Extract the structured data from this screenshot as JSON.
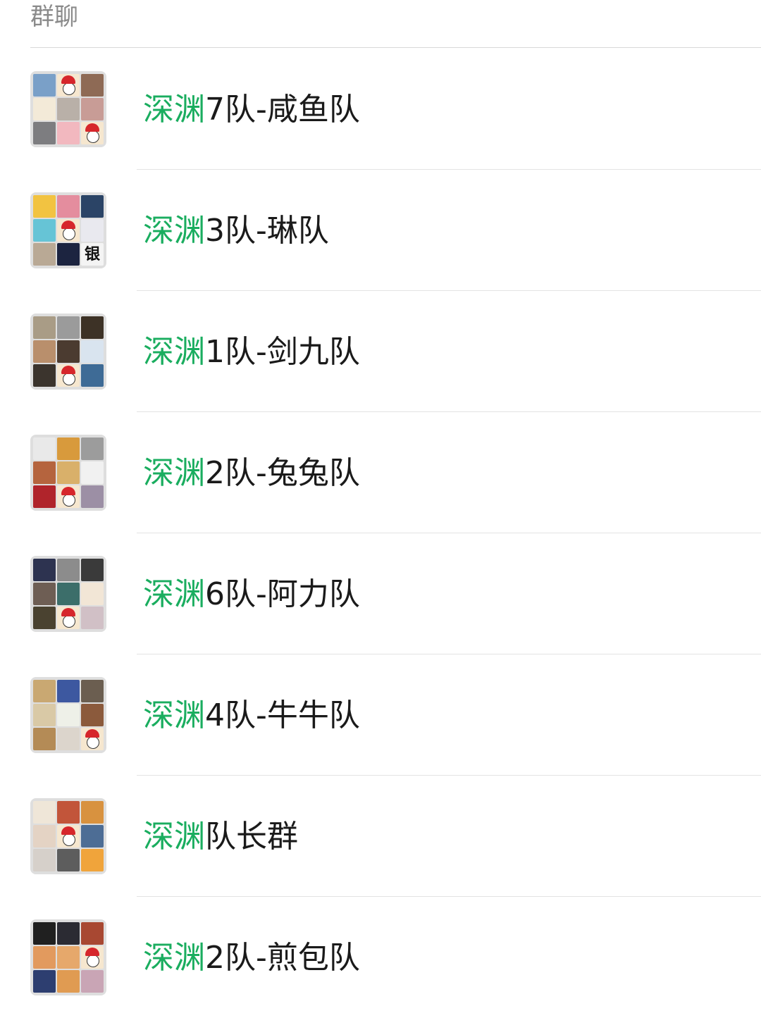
{
  "section": {
    "title": "群聊"
  },
  "colors": {
    "highlight": "#1aad5f",
    "text": "#1a1a1a",
    "header": "#8a8a8a"
  },
  "groups": [
    {
      "match": "深渊",
      "rest": "7队-咸鱼队",
      "avatar_tiles": [
        "#7aa0c8",
        "santa",
        "#8e6a55",
        "#f3ead8",
        "#b9b0a8",
        "#c89c96",
        "#7d7d80",
        "#f2b8bf",
        "santa"
      ]
    },
    {
      "match": "深渊",
      "rest": "3队-琳队",
      "avatar_tiles": [
        "#f2c341",
        "#e48d9e",
        "#2b4466",
        "#66c4d6",
        "santa",
        "#e9e9ef",
        "#b9a995",
        "#1c2440",
        "glyph:银"
      ]
    },
    {
      "match": "深渊",
      "rest": "1队-剑九队",
      "avatar_tiles": [
        "#a99c86",
        "#9b9b9b",
        "#3d3226",
        "#b98f6c",
        "#4b3b30",
        "#d9e4ef",
        "#3b342d",
        "santa",
        "#3e6b96"
      ]
    },
    {
      "match": "深渊",
      "rest": "2队-兔兔队",
      "avatar_tiles": [
        "#e9e9e9",
        "#d89a3c",
        "#9c9c9c",
        "#b5643e",
        "#d9b06a",
        "#f1f1f1",
        "#b0242b",
        "santa",
        "#9c8fa5"
      ]
    },
    {
      "match": "深渊",
      "rest": "6队-阿力队",
      "avatar_tiles": [
        "#2d3350",
        "#8c8c8c",
        "#3a3a3a",
        "#6e5e54",
        "#3c6e6a",
        "#f2e6d6",
        "#4a4230",
        "santa",
        "#d1c0c6"
      ]
    },
    {
      "match": "深渊",
      "rest": "4队-牛牛队",
      "avatar_tiles": [
        "#c9a872",
        "#3d58a0",
        "#6b5e50",
        "#d9c9a6",
        "#eef0e8",
        "#8b5a3c",
        "#b48b56",
        "#dcd5cc",
        "santa"
      ]
    },
    {
      "match": "深渊",
      "rest": "队长群",
      "avatar_tiles": [
        "#efe6d8",
        "#c2553a",
        "#d8923f",
        "#e4d3c4",
        "santa",
        "#4d6d95",
        "#d6d0ca",
        "#5d5d5d",
        "#f0a43b"
      ]
    },
    {
      "match": "深渊",
      "rest": "2队-煎包队",
      "avatar_tiles": [
        "#202020",
        "#2b2b33",
        "#a84832",
        "#e29a5e",
        "#e6a86b",
        "santa",
        "#2d3e70",
        "#e09b52",
        "#c9a5b5"
      ]
    }
  ]
}
